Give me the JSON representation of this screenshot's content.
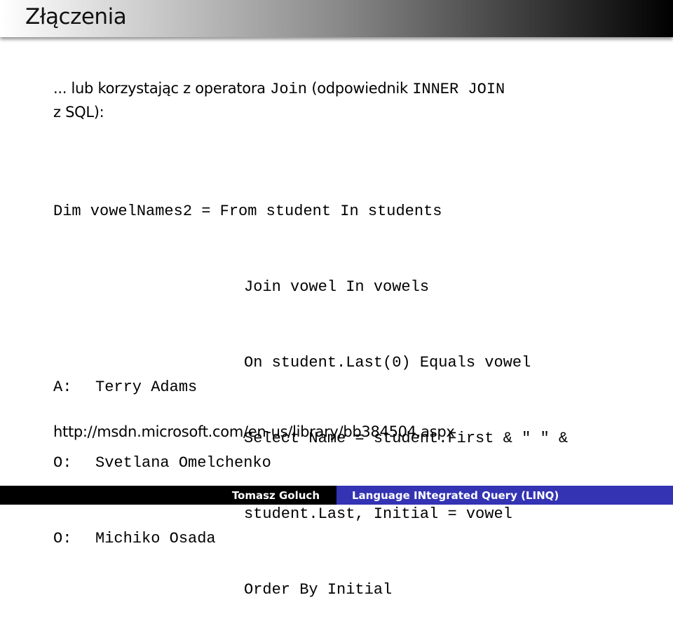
{
  "slide": {
    "title": "Złączenia"
  },
  "intro": {
    "text_before": "... lub korzystając z operatora ",
    "operator": "Join",
    "text_middle": " (odpowiednik ",
    "sql_term": "INNER JOIN",
    "text_line2": "z SQL):"
  },
  "code": {
    "lines": [
      "Dim vowelNames2 = From student In students",
      "Join vowel In vowels",
      "On student.Last(0) Equals vowel",
      "Select Name = student.First & \" \" &",
      "student.Last, Initial = vowel",
      "Order By Initial"
    ]
  },
  "results": [
    {
      "key": "A:",
      "value": "Terry Adams"
    },
    {
      "key": "O:",
      "value": "Svetlana Omelchenko"
    },
    {
      "key": "O:",
      "value": "Michiko Osada"
    }
  ],
  "source_link": "http://msdn.microsoft.com/en-us/library/bb384504.aspx",
  "footer": {
    "author": "Tomasz Goluch",
    "presentation_title": "Language INtegrated Query (LINQ)",
    "colors": {
      "author_bg": "#000000",
      "title_bg": "#3333b3"
    }
  }
}
